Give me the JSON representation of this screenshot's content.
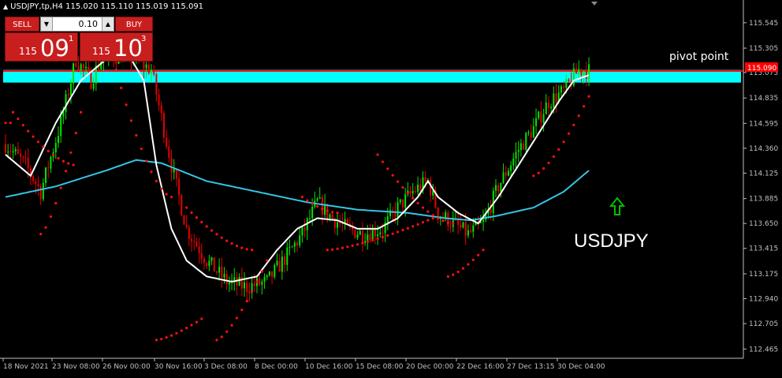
{
  "header": {
    "symbol_info": "USDJPY,tp,H4",
    "ohlc": "115.020 115.110 115.019 115.091"
  },
  "trade_panel": {
    "sell_label": "SELL",
    "buy_label": "BUY",
    "volume": "0.10",
    "sell_price": {
      "prefix": "115",
      "big": "09",
      "sup": "1"
    },
    "buy_price": {
      "prefix": "115",
      "big": "10",
      "sup": "3"
    }
  },
  "annotations": {
    "pivot_label": "pivot point",
    "symbol_label": "USDJPY",
    "price_tag": "115.090"
  },
  "colors": {
    "background": "#000000",
    "bull": "#00e600",
    "bear": "#e60000",
    "axis": "#c0c0c0",
    "zone": "#00ffff",
    "pivot_line": "#ff0000",
    "ma_fast": "#ffffff",
    "ma_slow": "#34c4e4",
    "sar": "#ff1010",
    "arrow": "#00c000",
    "panel_red": "#c81e1e"
  },
  "chart_data": {
    "type": "candlestick",
    "ylim": [
      112.4,
      115.7
    ],
    "yticks": [
      "115.545",
      "115.305",
      "115.075",
      "114.835",
      "114.595",
      "114.360",
      "114.125",
      "113.885",
      "113.650",
      "113.415",
      "113.175",
      "112.940",
      "112.705",
      "112.465"
    ],
    "xticks": [
      "18 Nov 2021",
      "23 Nov 08:00",
      "26 Nov 00:00",
      "30 Nov 16:00",
      "3 Dec 08:00",
      "8 Dec 00:00",
      "10 Dec 16:00",
      "15 Dec 08:00",
      "20 Dec 00:00",
      "22 Dec 16:00",
      "27 Dec 13:15",
      "30 Dec 04:00"
    ],
    "candle_count": 233,
    "price_path": [
      [
        0,
        114.4
      ],
      [
        8,
        114.2
      ],
      [
        14,
        113.95
      ],
      [
        22,
        114.6
      ],
      [
        28,
        115.2
      ],
      [
        34,
        115.0
      ],
      [
        38,
        115.2
      ],
      [
        48,
        115.25
      ],
      [
        58,
        115.1
      ],
      [
        66,
        114.2
      ],
      [
        72,
        113.6
      ],
      [
        80,
        113.3
      ],
      [
        88,
        113.1
      ],
      [
        96,
        113.05
      ],
      [
        104,
        113.1
      ],
      [
        112,
        113.35
      ],
      [
        118,
        113.55
      ],
      [
        124,
        113.85
      ],
      [
        130,
        113.7
      ],
      [
        136,
        113.6
      ],
      [
        142,
        113.55
      ],
      [
        150,
        113.6
      ],
      [
        156,
        113.8
      ],
      [
        162,
        113.95
      ],
      [
        168,
        114.05
      ],
      [
        172,
        113.75
      ],
      [
        178,
        113.65
      ],
      [
        184,
        113.55
      ],
      [
        190,
        113.65
      ],
      [
        196,
        114.0
      ],
      [
        204,
        114.35
      ],
      [
        210,
        114.55
      ],
      [
        216,
        114.8
      ],
      [
        222,
        114.9
      ],
      [
        228,
        115.1
      ],
      [
        232,
        115.09
      ]
    ],
    "ma_fast": [
      [
        0,
        114.3
      ],
      [
        10,
        114.1
      ],
      [
        20,
        114.6
      ],
      [
        30,
        115.0
      ],
      [
        40,
        115.2
      ],
      [
        50,
        115.2
      ],
      [
        55,
        115.0
      ],
      [
        60,
        114.2
      ],
      [
        66,
        113.6
      ],
      [
        72,
        113.3
      ],
      [
        80,
        113.15
      ],
      [
        90,
        113.1
      ],
      [
        100,
        113.15
      ],
      [
        108,
        113.4
      ],
      [
        116,
        113.6
      ],
      [
        124,
        113.7
      ],
      [
        132,
        113.68
      ],
      [
        140,
        113.6
      ],
      [
        148,
        113.6
      ],
      [
        156,
        113.7
      ],
      [
        164,
        113.9
      ],
      [
        168,
        114.05
      ],
      [
        172,
        113.9
      ],
      [
        180,
        113.75
      ],
      [
        188,
        113.65
      ],
      [
        196,
        113.9
      ],
      [
        204,
        114.2
      ],
      [
        212,
        114.5
      ],
      [
        220,
        114.8
      ],
      [
        226,
        115.0
      ],
      [
        232,
        115.05
      ]
    ],
    "ma_slow": [
      [
        0,
        113.9
      ],
      [
        20,
        114.0
      ],
      [
        40,
        114.15
      ],
      [
        52,
        114.25
      ],
      [
        62,
        114.22
      ],
      [
        80,
        114.05
      ],
      [
        100,
        113.95
      ],
      [
        120,
        113.85
      ],
      [
        140,
        113.78
      ],
      [
        160,
        113.75
      ],
      [
        175,
        113.7
      ],
      [
        185,
        113.68
      ],
      [
        195,
        113.72
      ],
      [
        210,
        113.8
      ],
      [
        222,
        113.95
      ],
      [
        232,
        114.15
      ]
    ],
    "sar_segments": [
      {
        "dir": "below",
        "from": 0,
        "to": 2,
        "start": 114.6,
        "end": 114.6
      },
      {
        "dir": "above",
        "from": 3,
        "to": 28,
        "start": 114.7,
        "end": 114.2
      },
      {
        "dir": "below",
        "from": 14,
        "to": 30,
        "start": 113.55,
        "end": 114.7
      },
      {
        "dir": "above",
        "from": 44,
        "to": 66,
        "start": 115.1,
        "end": 113.9
      },
      {
        "dir": "below",
        "from": 60,
        "to": 78,
        "start": 112.55,
        "end": 112.75
      },
      {
        "dir": "above",
        "from": 72,
        "to": 98,
        "start": 113.8,
        "end": 113.4
      },
      {
        "dir": "below",
        "from": 84,
        "to": 104,
        "start": 112.55,
        "end": 113.3
      },
      {
        "dir": "above",
        "from": 118,
        "to": 132,
        "start": 113.9,
        "end": 113.75
      },
      {
        "dir": "below",
        "from": 128,
        "to": 170,
        "start": 113.4,
        "end": 113.7
      },
      {
        "dir": "above",
        "from": 148,
        "to": 178,
        "start": 114.3,
        "end": 113.65
      },
      {
        "dir": "below",
        "from": 176,
        "to": 190,
        "start": 113.15,
        "end": 113.4
      },
      {
        "dir": "below",
        "from": 210,
        "to": 232,
        "start": 114.1,
        "end": 114.85
      }
    ],
    "zone_band": [
      114.98,
      115.1
    ],
    "pivot_price": 115.09
  }
}
